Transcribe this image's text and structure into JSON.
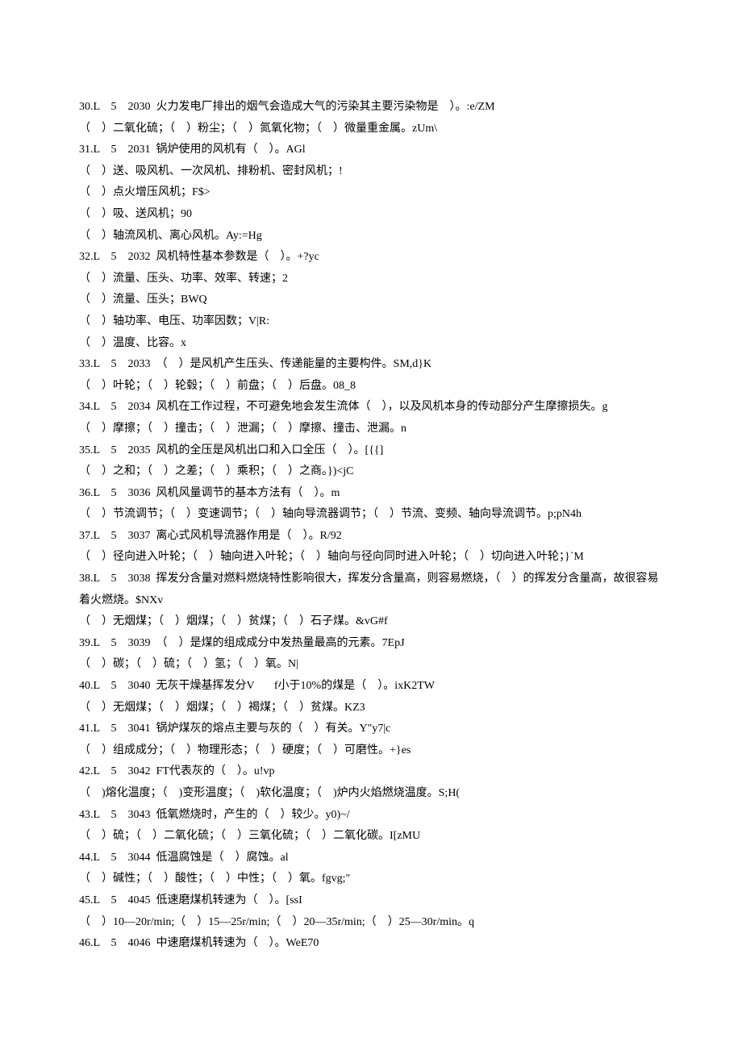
{
  "lines": [
    "30.L    5    2030  火力发电厂排出的烟气会造成大气的污染其主要污染物是    ）。:e/ZM",
    "（    ）二氧化硫；（    ）粉尘；（    ）氮氧化物；（    ）微量重金属。zUm\\",
    "31.L    5    2031  锅炉使用的风机有（    ）。AGl",
    "（    ）送、吸风机、一次风机、排粉机、密封风机；!",
    "（    ）点火增压风机；F$>",
    "（    ）吸、送风机；90",
    "（    ）轴流风机、离心风机。Ay:=Hg",
    "32.L    5    2032  风机特性基本参数是（    ）。+?yc",
    "（    ）流量、压头、功率、效率、转速；2",
    "（    ）流量、压头；BWQ",
    "（    ）轴功率、电压、功率因数；V|R:",
    "（    ）温度、比容。x",
    "33.L    5    2033  （    ）是风机产生压头、传递能量的主要构件。SM,d}K",
    "（    ）叶轮；（    ）轮毂；（    ）前盘；（    ）后盘。08_8",
    "34.L    5    2034  风机在工作过程，不可避免地会发生流体（    ），以及风机本身的传动部分产生摩擦损失。g",
    "（    ）摩擦；（    ）撞击；（    ）泄漏；（    ）摩擦、撞击、泄漏。n",
    "35.L    5    2035  风机的全压是风机出口和入口全压（    ）。[{{]",
    "（    ）之和；（    ）之差；（    ）乘积；（    ）之商。})<jC",
    "36.L    5    3036  风机风量调节的基本方法有（    ）。m",
    "（    ）节流调节；（    ）变速调节；（    ）轴向导流器调节；（    ）节流、变频、轴向导流调节。p;pN4h",
    "37.L    5    3037  离心式风机导流器作用是（    ）。R/92",
    "（    ）径向进入叶轮；（    ）轴向进入叶轮；（    ）轴向与径向同时进入叶轮；（    ）切向进入叶轮；}`M",
    "38.L    5    3038  挥发分含量对燃料燃烧特性影响很大，挥发分含量高，则容易燃烧，（    ）的挥发分含量高，故很容易着火燃烧。$NXv",
    "（    ）无烟煤；（    ）烟煤；（    ）贫煤；（    ）石子煤。&vG#f",
    "39.L    5    3039  （    ）是煤的组成成分中发热量最高的元素。7EpJ",
    "（    ）碳；（    ）硫；（    ）氢；（    ）氧。N|",
    "40.L    5    3040  无灰干燥基挥发分V       f小于10%的煤是（    ）。ixK2TW",
    "（    ）无烟煤；（    ）烟煤；（    ）褐煤；（    ）贫煤。KZ3",
    "41.L    5    3041  锅炉煤灰的熔点主要与灰的（    ）有关。Y\"y7|c",
    "（    ）组成成分；（    ）物理形态；（    ）硬度；（    ）可磨性。+}es",
    "42.L    5    3042  FT代表灰的（    ）。u!vp",
    "（    )熔化温度；（    )变形温度；（    )软化温度；（    )炉内火焰燃烧温度。S;H(",
    "43.L    5    3043  低氧燃烧时，产生的（    ）较少。y0)~/",
    "（    ）硫；（    ）二氧化硫；（    ）三氧化硫；（    ）二氧化碳。I[zMU",
    "44.L    5    3044  低温腐蚀是（    ）腐蚀。al",
    "（    ）碱性；（    ）酸性；（    ）中性；（    ）氧。fgvg;\"",
    "45.L    5    4045  低速磨煤机转速为（    ）。[ssI",
    "（    ）10—20r/min;（    ）15—25r/min;（    ）20—35r/min;（    ）25—30r/min。q",
    "",
    "46.L    5    4046  中速磨煤机转速为（    ）。WeE70"
  ]
}
